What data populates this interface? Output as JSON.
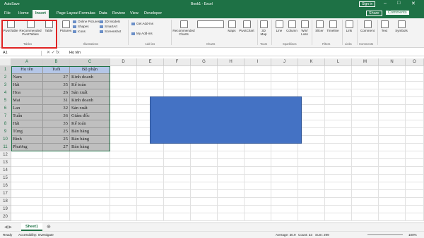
{
  "titlebar": {
    "autosave": "AutoSave",
    "book": "Book1 - Excel",
    "signin": "Sign in"
  },
  "tabs": [
    "File",
    "Home",
    "Insert",
    "Page Layout",
    "Formulas",
    "Data",
    "Review",
    "View",
    "Developer"
  ],
  "share": "Share",
  "comments": "Comments",
  "ribbon": {
    "pivot": "PivotTable",
    "recpivot": "Recommended PivotTables",
    "table": "Table",
    "tables_group": "Tables",
    "pictures": "Pictures",
    "online": "Online Pictures",
    "shapes": "Shapes",
    "icons": "Icons",
    "models": "3D Models",
    "smartart": "SmartArt",
    "screenshot": "Screenshot",
    "illus_group": "Illustrations",
    "getaddins": "Get Add-ins",
    "myaddins": "My Add-ins",
    "addins_group": "Add-ins",
    "reccharts": "Recommended Charts",
    "maps": "Maps",
    "pivotchart": "PivotChart",
    "charts_group": "Charts",
    "map3d": "3D Map",
    "tours_group": "Tours",
    "line": "Line",
    "column": "Column",
    "winloss": "Win/ Loss",
    "spark_group": "Sparklines",
    "slicer": "Slicer",
    "timeline": "Timeline",
    "filters_group": "Filters",
    "link": "Link",
    "links_group": "Links",
    "comment": "Comment",
    "comments_group": "Comments",
    "text": "Text",
    "symbols": "Symbols"
  },
  "namebox": "A1",
  "formula": "Họ tên",
  "columns": [
    "A",
    "B",
    "C",
    "D",
    "E",
    "F",
    "G",
    "H",
    "I",
    "J",
    "K",
    "L",
    "M",
    "N",
    "O"
  ],
  "rows": [
    "1",
    "2",
    "3",
    "4",
    "5",
    "6",
    "7",
    "8",
    "9",
    "10",
    "11",
    "12",
    "13",
    "14",
    "15",
    "16",
    "17",
    "18",
    "19",
    "20"
  ],
  "table": [
    [
      "Họ tên",
      "Tuổi",
      "Bộ phận"
    ],
    [
      "Nam",
      "27",
      "Kinh doanh"
    ],
    [
      "Hải",
      "35",
      "Kế toán"
    ],
    [
      "Hoa",
      "26",
      "Sản xuất"
    ],
    [
      "Mai",
      "31",
      "Kinh doanh"
    ],
    [
      "Lan",
      "32",
      "Sản xuất"
    ],
    [
      "Tuấn",
      "36",
      "Giám đốc"
    ],
    [
      "Hải",
      "35",
      "Kế toán"
    ],
    [
      "Tùng",
      "25",
      "Bán hàng"
    ],
    [
      "Bình",
      "25",
      "Bán hàng"
    ],
    [
      "Phương",
      "27",
      "Bán hàng"
    ]
  ],
  "sheet": "Sheet1",
  "status": {
    "ready": "Ready",
    "access": "Accessibility: Investigate",
    "average": "Average: 30.9",
    "count": "Count: 33",
    "sum": "Sum: 299",
    "zoom": "100%"
  }
}
